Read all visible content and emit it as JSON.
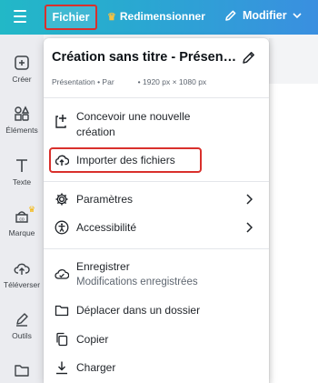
{
  "topbar": {
    "menu_icon": "hamburger-icon",
    "file_label": "Fichier",
    "resize_label": "Redimensionner",
    "edit_label": "Modifier",
    "accent": "#22b8c7"
  },
  "rail": {
    "items": [
      {
        "label": "Créer",
        "icon": "plus-square-icon"
      },
      {
        "label": "Éléments",
        "icon": "shapes-icon"
      },
      {
        "label": "Texte",
        "icon": "text-icon"
      },
      {
        "label": "Marque",
        "icon": "brand-icon"
      },
      {
        "label": "Téléverser",
        "icon": "upload-cloud-icon"
      },
      {
        "label": "Outils",
        "icon": "pen-icon"
      },
      {
        "label": "",
        "icon": "folder-icon"
      }
    ]
  },
  "menu": {
    "title": "Création sans titre - Présen…",
    "meta_type": "Présentation • Par",
    "meta_size": "• 1920 px × 1080 px",
    "items": [
      {
        "label_line1": "Concevoir une nouvelle",
        "label_line2": "création",
        "icon": "new-design-icon"
      },
      {
        "label": "Importer des fichiers",
        "icon": "cloud-upload-icon"
      },
      {
        "label": "Paramètres",
        "icon": "settings-icon"
      },
      {
        "label": "Accessibilité",
        "icon": "accessibility-icon"
      },
      {
        "label": "Enregistrer",
        "sub": "Modifications enregistrées",
        "icon": "cloud-check-icon"
      },
      {
        "label": "Déplacer dans un dossier",
        "icon": "folder-icon"
      },
      {
        "label": "Copier",
        "icon": "copy-icon"
      },
      {
        "label": "Charger",
        "icon": "download-icon"
      }
    ]
  },
  "colors": {
    "highlight": "#d9302c",
    "text": "#1f2328"
  }
}
